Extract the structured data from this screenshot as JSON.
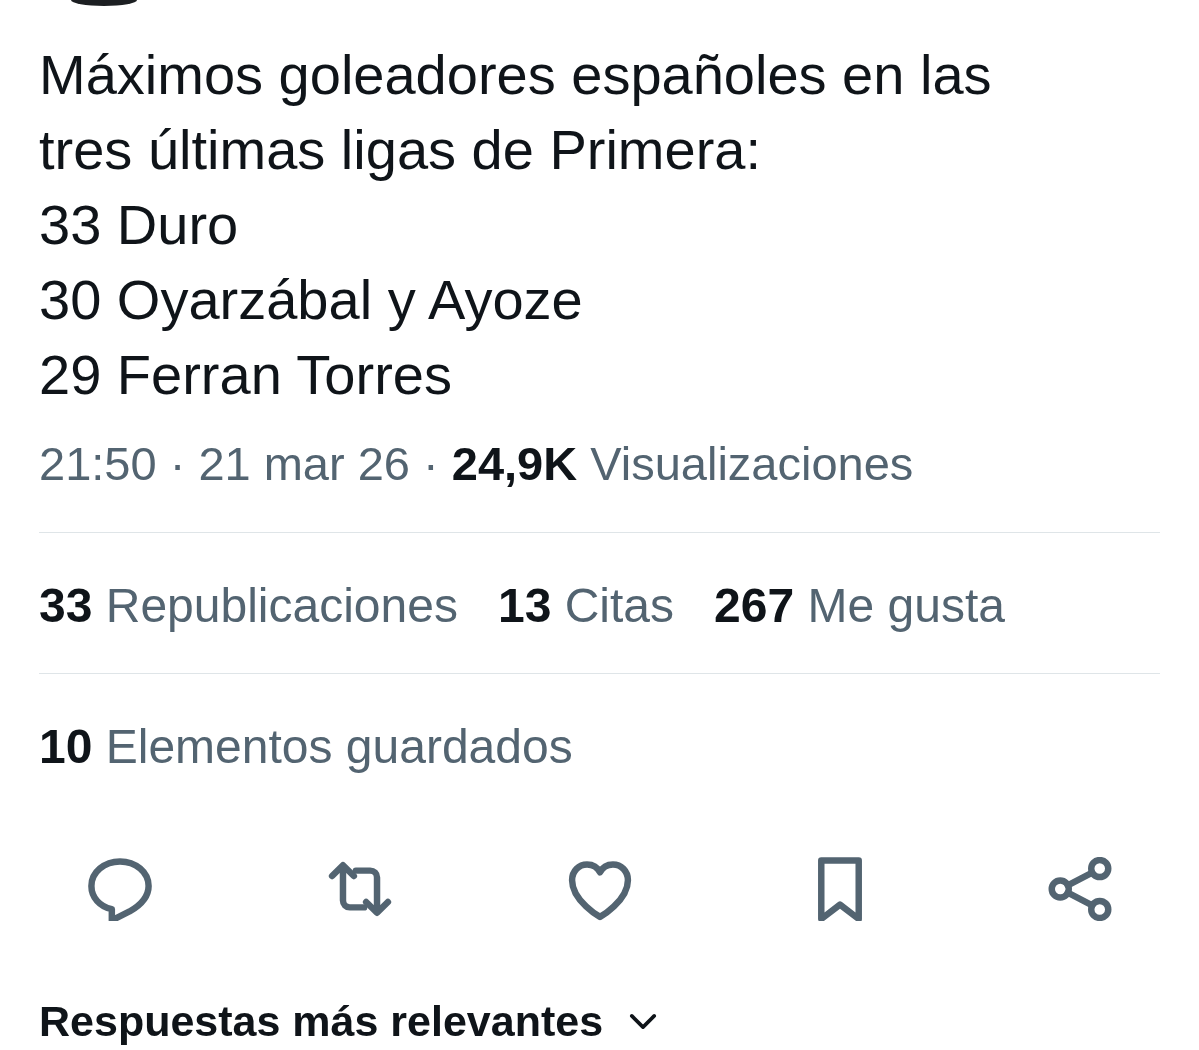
{
  "post": {
    "text": "Máximos goleadores españoles en las tres últimas ligas de Primera:\n33 Duro\n30 Oyarzábal y Ayoze\n29 Ferran Torres",
    "meta": "21:50 · 21 mar 26 · **24,9K** Visualizaciones"
  },
  "stats": [
    {
      "count": "33",
      "label": "Republicaciones"
    },
    {
      "count": "13",
      "label": "Citas"
    },
    {
      "count": "267",
      "label": "Me gusta"
    }
  ],
  "saved": {
    "count": "10",
    "label": "Elementos guardados"
  },
  "actions": [
    {
      "kind": "reply"
    },
    {
      "kind": "repost"
    },
    {
      "kind": "like"
    },
    {
      "kind": "bookmark"
    },
    {
      "kind": "share"
    }
  ],
  "replies_sort": {
    "label": "Respuestas más relevantes"
  }
}
